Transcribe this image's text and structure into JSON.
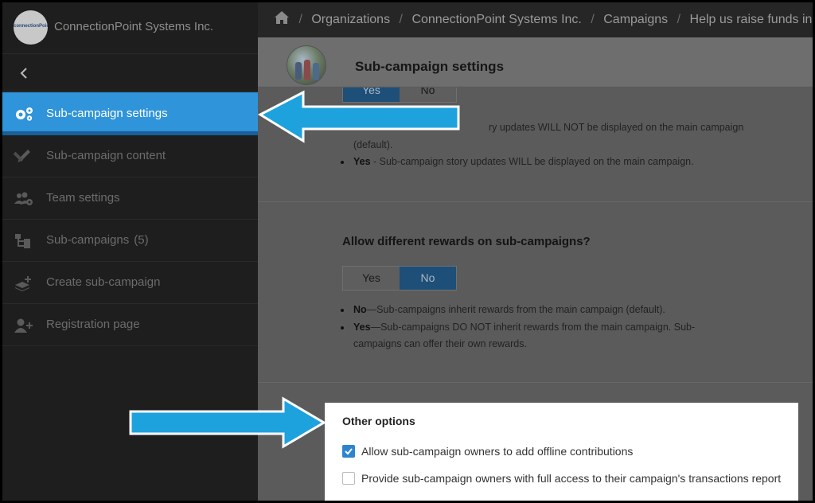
{
  "org": {
    "name": "ConnectionPoint Systems Inc.",
    "logo_text": "connectionPoint"
  },
  "sidebar": {
    "items": [
      {
        "label": "Sub-campaign settings",
        "count": ""
      },
      {
        "label": "Sub-campaign content",
        "count": ""
      },
      {
        "label": "Team settings",
        "count": ""
      },
      {
        "label": "Sub-campaigns",
        "count": "(5)"
      },
      {
        "label": "Create sub-campaign",
        "count": ""
      },
      {
        "label": "Registration page",
        "count": ""
      }
    ]
  },
  "breadcrumb": {
    "items": [
      "Organizations",
      "ConnectionPoint Systems Inc.",
      "Campaigns",
      "Help us raise funds in our F"
    ]
  },
  "header": {
    "title": "Sub-campaign settings"
  },
  "story_section": {
    "yes": "Yes",
    "no": "No",
    "bullet1_tail": "ry updates WILL NOT be displayed on the main campaign",
    "bullet1_line2": "(default).",
    "bullet2_bold": "Yes",
    "bullet2_text": " - Sub-campaign story updates WILL be displayed on the main campaign."
  },
  "rewards_section": {
    "title": "Allow different rewards on sub-campaigns?",
    "yes": "Yes",
    "no": "No",
    "bullet1_bold": "No",
    "bullet1_text": "—Sub-campaigns inherit rewards from the main campaign (default).",
    "bullet2_bold": "Yes",
    "bullet2_text": "—Sub-campaigns DO NOT inherit rewards from the main campaign. Sub-",
    "bullet2_line2": "campaigns can offer their own rewards."
  },
  "other_options": {
    "title": "Other options",
    "options": [
      {
        "label": "Allow sub-campaign owners to add offline contributions",
        "checked": true
      },
      {
        "label": "Provide sub-campaign owners with full access to their campaign's transactions report",
        "checked": false
      }
    ]
  },
  "colors": {
    "accent": "#2f94d9",
    "arrow": "#1ea2dd",
    "toggle_on": "#1d4f79"
  }
}
